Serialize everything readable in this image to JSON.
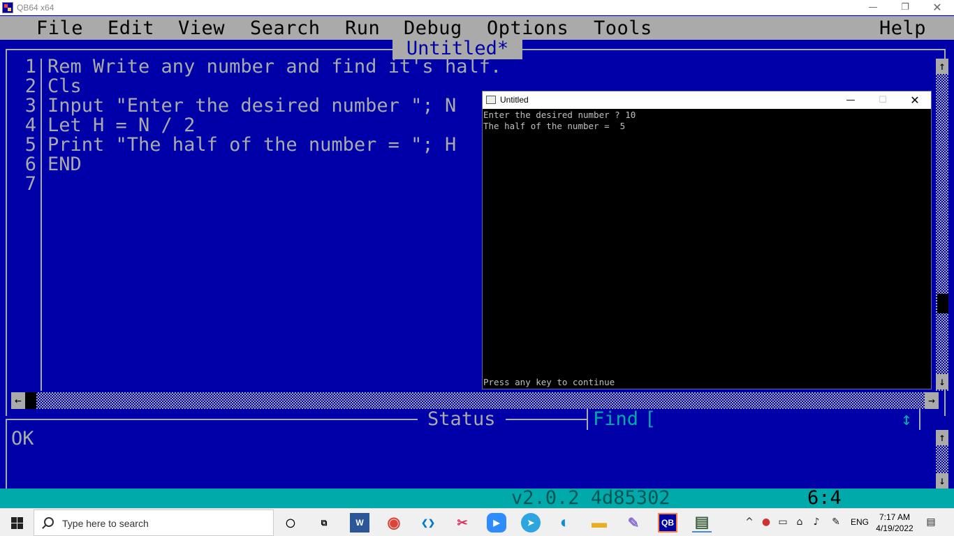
{
  "window": {
    "title": "QB64 x64",
    "controls": {
      "minimize": "—",
      "restore": "❐",
      "close": "✕"
    }
  },
  "menu": {
    "items": [
      "File",
      "Edit",
      "View",
      "Search",
      "Run",
      "Debug",
      "Options",
      "Tools",
      "Help"
    ]
  },
  "editor": {
    "doc_title": "Untitled*",
    "line_numbers": [
      "1",
      "2",
      "3",
      "4",
      "5",
      "6",
      "7"
    ],
    "lines": [
      "Rem Write any number and find it's half.",
      "Cls",
      "Input \"Enter the desired number \"; N",
      "Let H = N / 2",
      "Print \"The half of the number = \"; H",
      "END",
      ""
    ],
    "scroll": {
      "up": "↑",
      "down": "↓",
      "left": "←",
      "right": "→"
    }
  },
  "status": {
    "label": "Status",
    "message": "OK",
    "find_label": "Find",
    "find_value": "[",
    "find_toggle": "↕"
  },
  "bottombar": {
    "version": "v2.0.2 4d85302",
    "cursor": "6:4"
  },
  "console": {
    "title": "Untitled",
    "lines": [
      "Enter the desired number ? 10",
      "The half of the number =  5"
    ],
    "footer": "Press any key to continue",
    "controls": {
      "minimize": "—",
      "maximize": "☐",
      "close": "✕"
    }
  },
  "taskbar": {
    "search_placeholder": "Type here to search",
    "time": "7:17 AM",
    "date": "4/19/2022",
    "language": "ENG",
    "apps": [
      {
        "name": "cortana-icon",
        "glyph": "◯",
        "color": "#222222"
      },
      {
        "name": "task-view-icon",
        "glyph": "⧉",
        "color": "#222222"
      },
      {
        "name": "word-icon",
        "glyph": "W",
        "color": "#2b579a"
      },
      {
        "name": "chrome-icon",
        "glyph": "◉",
        "color": "#db4437"
      },
      {
        "name": "vscode-icon",
        "glyph": "❮❯",
        "color": "#007acc"
      },
      {
        "name": "snipping-icon",
        "glyph": "✂",
        "color": "#e03060"
      },
      {
        "name": "zoom-icon",
        "glyph": "▶",
        "color": "#2d8cff"
      },
      {
        "name": "telegram-icon",
        "glyph": "➤",
        "color": "#2ca5e0"
      },
      {
        "name": "edge-icon",
        "glyph": "◐",
        "color": "#0c8fd6"
      },
      {
        "name": "file-explorer-icon",
        "glyph": "▬",
        "color": "#e8b020"
      },
      {
        "name": "paint-icon",
        "glyph": "✎",
        "color": "#8a6fd0"
      },
      {
        "name": "qb64-icon",
        "glyph": "QB",
        "color": "#ffffff"
      },
      {
        "name": "console-app-icon",
        "glyph": "▤",
        "color": "#446644"
      }
    ]
  }
}
